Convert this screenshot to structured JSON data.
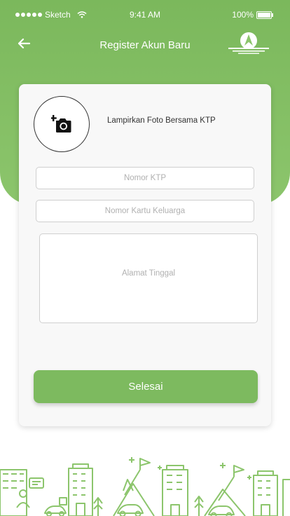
{
  "status_bar": {
    "carrier": "Sketch",
    "time": "9:41 AM",
    "battery": "100%"
  },
  "header": {
    "title": "Register Akun Baru"
  },
  "form": {
    "photo_label": "Lampirkan Foto Bersama KTP",
    "ktp_placeholder": "Nomor KTP",
    "kk_placeholder": "Nomor Kartu Keluarga",
    "address_placeholder": "Alamat Tinggal",
    "submit_label": "Selesai"
  },
  "colors": {
    "brand_green": "#7dba5f",
    "card_background": "#f8f8f8",
    "illustration_green": "#8cc56c"
  },
  "icons": [
    "back-arrow-icon",
    "app-logo",
    "add-photo-icon",
    "city-illustration"
  ]
}
